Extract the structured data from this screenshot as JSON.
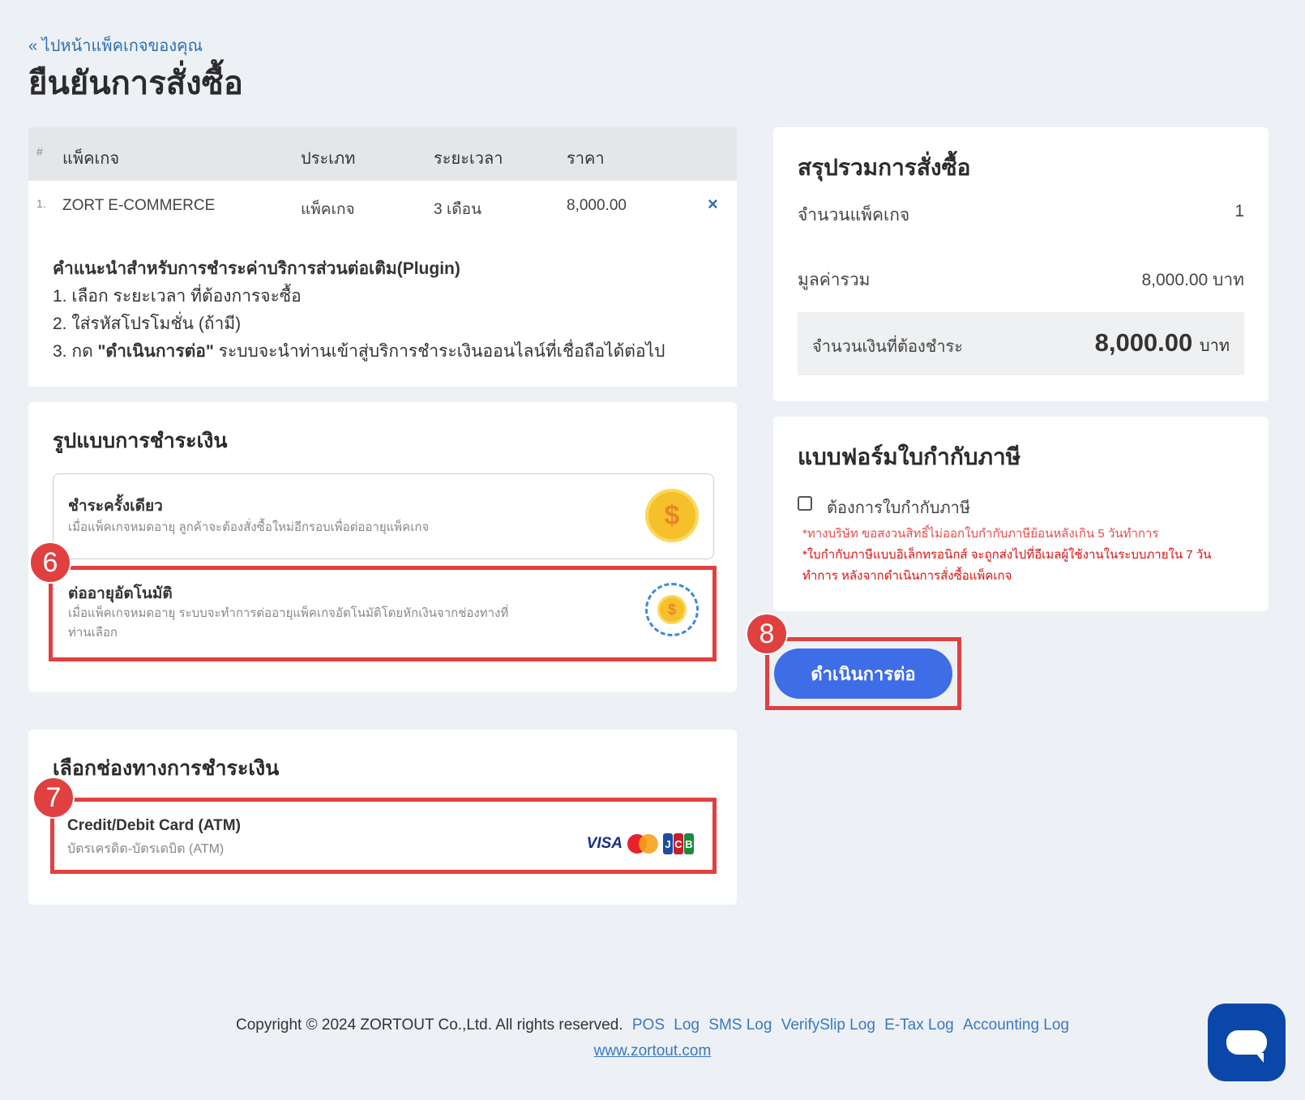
{
  "header": {
    "back_link": "« ไปหน้าแพ็คเกจของคุณ",
    "title": "ยืนยันการสั่งซื้อ"
  },
  "package_table": {
    "columns": [
      "#",
      "แพ็คเกจ",
      "ประเภท",
      "ระยะเวลา",
      "ราคา"
    ],
    "rows": [
      {
        "index": "1.",
        "name": "ZORT E-COMMERCE",
        "type": "แพ็คเกจ",
        "duration": "3 เดือน",
        "price": "8,000.00",
        "remove": "×"
      }
    ]
  },
  "instructions": {
    "title": "คำแนะนำสำหรับการชำระค่าบริการส่วนต่อเติม(Plugin)",
    "step1": "1. เลือก ระยะเวลา ที่ต้องการจะซื้อ",
    "step2": "2. ใส่รหัสโปรโมชั่น (ถ้ามี)",
    "step3_prefix": "3. กด ",
    "step3_bold": "\"ดำเนินการต่อ\"",
    "step3_suffix": " ระบบจะนำท่านเข้าสู่บริการชำระเงินออนไลน์ที่เชื่อถือได้ต่อไป"
  },
  "payment_type": {
    "title": "รูปแบบการชำระเงิน",
    "options": [
      {
        "title": "ชำระครั้งเดียว",
        "desc": "เมื่อแพ็คเกจหมดอายุ ลูกค้าจะต้องสั่งซื้อใหม่อีกรอบเพื่อต่ออายุแพ็คเกจ",
        "icon_symbol": "$"
      },
      {
        "title": "ต่ออายุอัตโนมัติ",
        "desc": "เมื่อแพ็คเกจหมดอายุ ระบบจะทำการต่ออายุแพ็คเกจอัตโนมัติโดยหักเงินจากช่องทางที่ท่านเลือก",
        "icon_symbol": "$"
      }
    ]
  },
  "payment_channel": {
    "title": "เลือกช่องทางการชำระเงิน",
    "option_title": "Credit/Debit Card (ATM)",
    "option_desc": "บัตรเครดิต-บัตรเดบิต (ATM)",
    "logo_visa": "VISA",
    "logo_jcb": [
      "J",
      "C",
      "B"
    ]
  },
  "summary": {
    "title": "สรุปรวมการสั่งซื้อ",
    "count_label": "จำนวนแพ็คเกจ",
    "count_value": "1",
    "subtotal_label": "มูลค่ารวม",
    "subtotal_value": "8,000.00 บาท",
    "total_label": "จำนวนเงินที่ต้องชำระ",
    "total_value": "8,000.00",
    "total_unit": "บาท"
  },
  "tax_form": {
    "title": "แบบฟอร์มใบกำกับภาษี",
    "checkbox_label": "ต้องการใบกำกับภาษี",
    "note1": "*ทางบริษัท ขอสงวนสิทธิ์ไม่ออกใบกำกับภาษีย้อนหลังเกิน 5 วันทำการ",
    "note2": "*ใบกำกับภาษีแบบอิเล็กทรอนิกส์ จะถูกส่งไปที่อีเมลผู้ใช้งานในระบบภายใน 7 วันทำการ หลังจากดำเนินการสั่งซื้อแพ็คเกจ"
  },
  "continue_button": "ดำเนินการต่อ",
  "step_badges": {
    "six": "6",
    "seven": "7",
    "eight": "8"
  },
  "footer": {
    "copyright": "Copyright © 2024 ZORTOUT Co.,Ltd. All rights reserved.",
    "links": [
      "POS",
      "Log",
      "SMS Log",
      "VerifySlip Log",
      "E-Tax Log",
      "Accounting Log"
    ],
    "site": "www.zortout.com"
  },
  "colors": {
    "accent": "#3e6de8",
    "highlight": "#e04040",
    "link": "#2f6fb0",
    "warning": "#e01010"
  }
}
